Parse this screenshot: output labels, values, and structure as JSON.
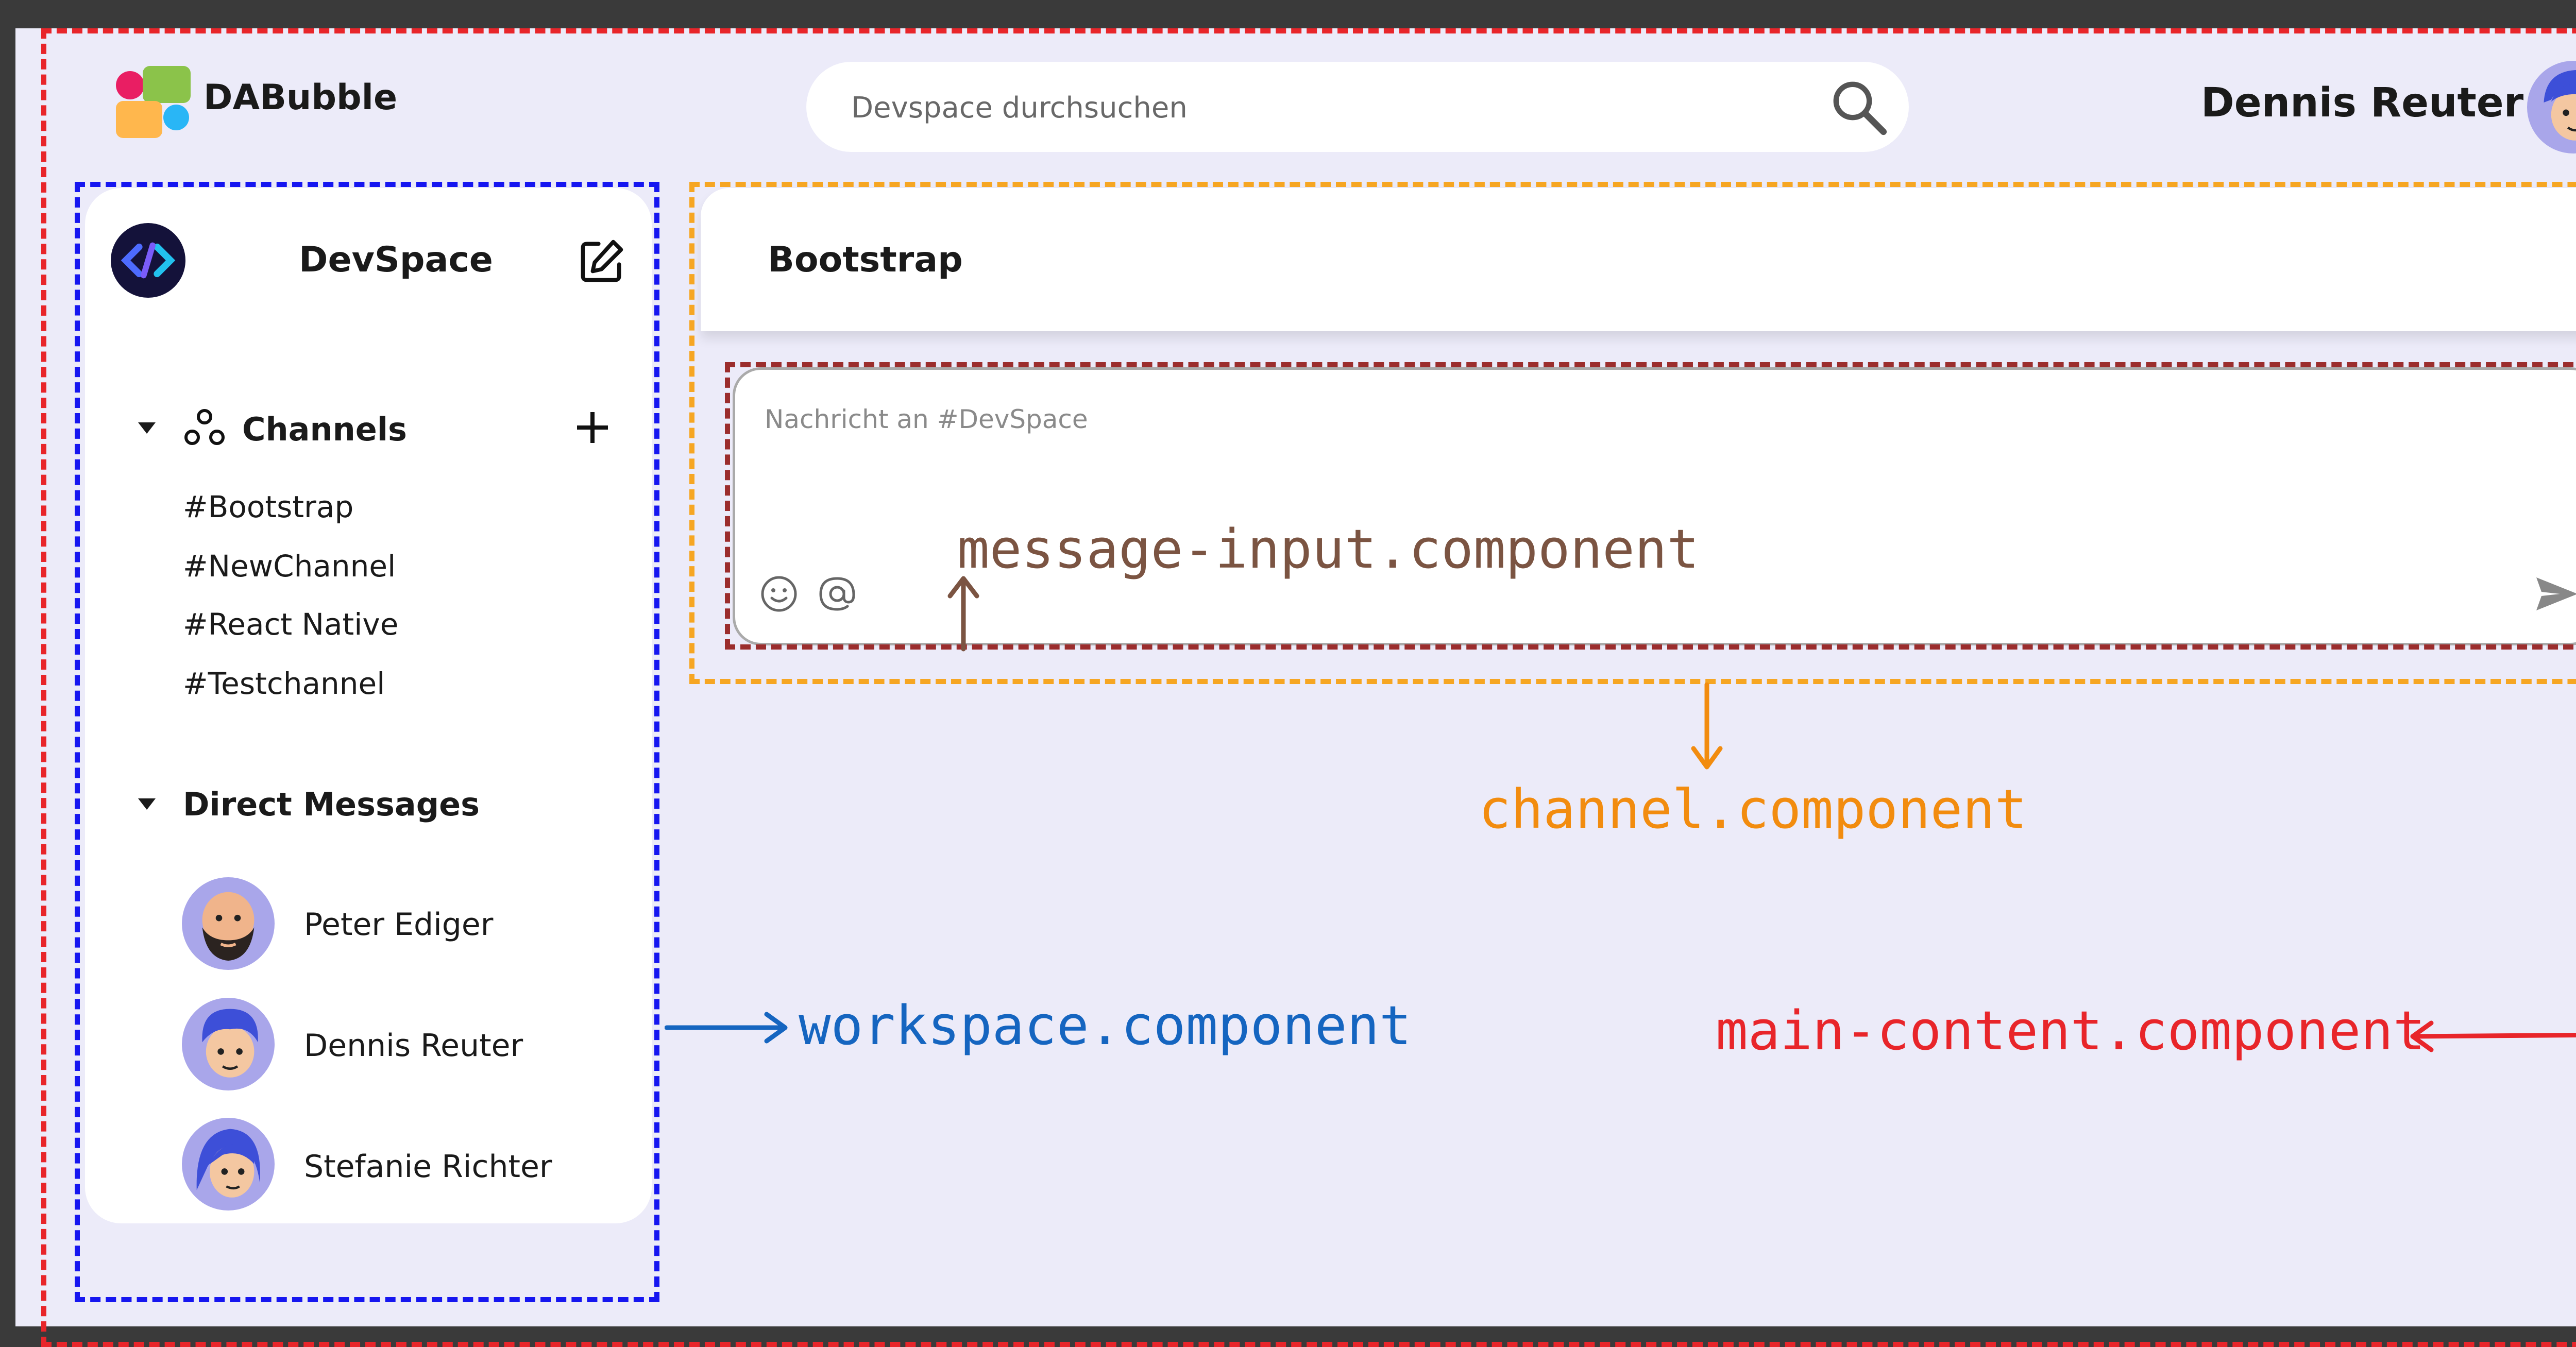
{
  "header": {
    "app_name": "DABubble",
    "search_placeholder": "Devspace durchsuchen",
    "user_name": "Dennis Reuter"
  },
  "workspace": {
    "title": "DevSpace",
    "channels_label": "Channels",
    "channels": [
      "#Bootstrap",
      "#NewChannel",
      "#React Native",
      "#Testchannel"
    ],
    "dm_label": "Direct Messages",
    "direct_messages": [
      "Peter Ediger",
      "Dennis Reuter",
      "Stefanie Richter"
    ]
  },
  "channel": {
    "title": "Bootstrap",
    "message_placeholder": "Nachricht an #DevSpace"
  },
  "annotations": {
    "message_input": "message-input.component",
    "channel": "channel.component",
    "workspace": "workspace.component",
    "main_content": "main-content.component"
  },
  "colors": {
    "background": "#ecebf9",
    "panel": "#ffffff",
    "annotation_main": "#e8252a",
    "annotation_workspace": "#1565c0",
    "annotation_channel": "#f28c0f",
    "annotation_message_input": "#7b5442",
    "avatar_bg": "#a9a6ea"
  },
  "icons": [
    "search-icon",
    "edit-icon",
    "channels-icon",
    "plus-icon",
    "caret-down-icon",
    "emoji-icon",
    "at-icon",
    "send-icon"
  ]
}
